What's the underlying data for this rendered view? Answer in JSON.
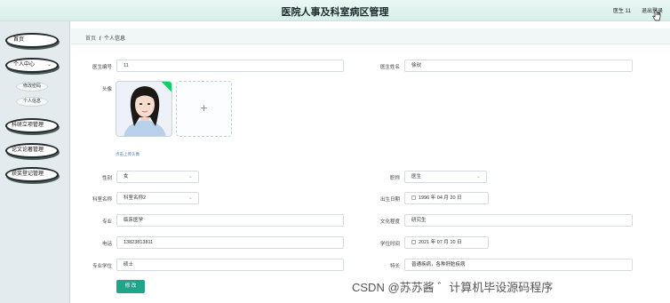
{
  "header": {
    "title": "医院人事及科室病区管理",
    "user": "医生 11",
    "logout": "退出登录"
  },
  "sidebar": {
    "items": [
      {
        "label": "首页"
      },
      {
        "label": "个人中心"
      },
      {
        "label": "科研立项管理"
      },
      {
        "label": "论文论著管理"
      },
      {
        "label": "获奖登记管理"
      }
    ],
    "sub_items": [
      {
        "label": "修改密码"
      },
      {
        "label": "个人信息"
      }
    ]
  },
  "breadcrumb": {
    "home": "首页",
    "separator": "/",
    "current": "个人信息"
  },
  "form": {
    "doctor_id": {
      "label": "医生编号",
      "value": "11"
    },
    "doctor_name": {
      "label": "医生姓名",
      "value": "徐欣"
    },
    "avatar": {
      "label": "头像",
      "upload_tip": "点击上传头像"
    },
    "gender": {
      "label": "性别",
      "value": "女"
    },
    "title": {
      "label": "职称",
      "value": "医生"
    },
    "dept": {
      "label": "科室名称",
      "value": "科室名称2"
    },
    "birth": {
      "label": "出生日期",
      "value": "1996 年 04 月 20 日"
    },
    "major": {
      "label": "专业",
      "value": "临床医学"
    },
    "education": {
      "label": "文化程度",
      "value": "研究生"
    },
    "phone": {
      "label": "电话",
      "value": "13823813811"
    },
    "degree_time": {
      "label": "学位时间",
      "value": "2021 年 07 月 10 日"
    },
    "degree": {
      "label": "专业学位",
      "value": "硕士"
    },
    "specialty": {
      "label": "特长",
      "value": "普通疾病，各种肝脏疾病"
    },
    "submit": "修 改"
  },
  "watermark": "CSDN @苏苏酱 ゛计算机毕设源码程序",
  "colors": {
    "accent": "#1fa68a",
    "header_bg": "#e3f4ef",
    "sidebar_bg": "#e3ebee"
  }
}
